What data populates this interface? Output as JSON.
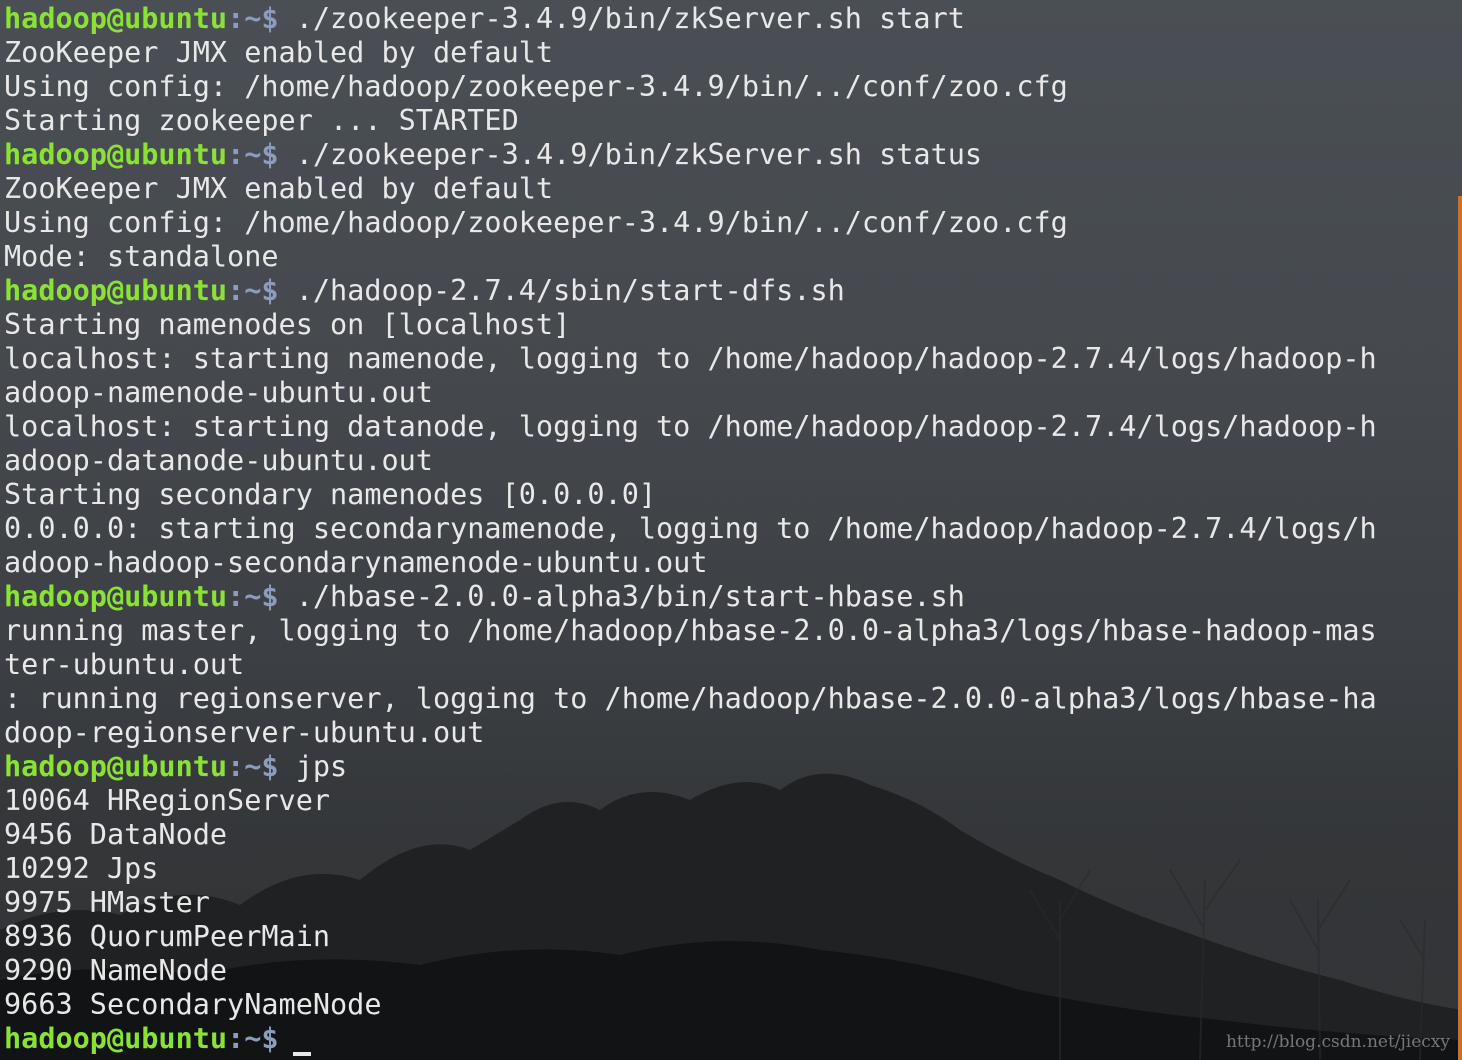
{
  "terminal": {
    "prompt": {
      "user_host": "hadoop@ubuntu",
      "sep": ":",
      "path": "~$"
    },
    "lines": [
      {
        "type": "cmd",
        "text": " ./zookeeper-3.4.9/bin/zkServer.sh start"
      },
      {
        "type": "out",
        "text": "ZooKeeper JMX enabled by default"
      },
      {
        "type": "out",
        "text": "Using config: /home/hadoop/zookeeper-3.4.9/bin/../conf/zoo.cfg"
      },
      {
        "type": "out",
        "text": "Starting zookeeper ... STARTED"
      },
      {
        "type": "cmd",
        "text": " ./zookeeper-3.4.9/bin/zkServer.sh status"
      },
      {
        "type": "out",
        "text": "ZooKeeper JMX enabled by default"
      },
      {
        "type": "out",
        "text": "Using config: /home/hadoop/zookeeper-3.4.9/bin/../conf/zoo.cfg"
      },
      {
        "type": "out",
        "text": "Mode: standalone"
      },
      {
        "type": "cmd",
        "text": " ./hadoop-2.7.4/sbin/start-dfs.sh"
      },
      {
        "type": "out",
        "text": "Starting namenodes on [localhost]"
      },
      {
        "type": "out",
        "text": "localhost: starting namenode, logging to /home/hadoop/hadoop-2.7.4/logs/hadoop-h"
      },
      {
        "type": "out",
        "text": "adoop-namenode-ubuntu.out"
      },
      {
        "type": "out",
        "text": "localhost: starting datanode, logging to /home/hadoop/hadoop-2.7.4/logs/hadoop-h"
      },
      {
        "type": "out",
        "text": "adoop-datanode-ubuntu.out"
      },
      {
        "type": "out",
        "text": "Starting secondary namenodes [0.0.0.0]"
      },
      {
        "type": "out",
        "text": "0.0.0.0: starting secondarynamenode, logging to /home/hadoop/hadoop-2.7.4/logs/h"
      },
      {
        "type": "out",
        "text": "adoop-hadoop-secondarynamenode-ubuntu.out"
      },
      {
        "type": "cmd",
        "text": " ./hbase-2.0.0-alpha3/bin/start-hbase.sh"
      },
      {
        "type": "out",
        "text": "running master, logging to /home/hadoop/hbase-2.0.0-alpha3/logs/hbase-hadoop-mas"
      },
      {
        "type": "out",
        "text": "ter-ubuntu.out"
      },
      {
        "type": "out",
        "text": ": running regionserver, logging to /home/hadoop/hbase-2.0.0-alpha3/logs/hbase-ha"
      },
      {
        "type": "out",
        "text": "doop-regionserver-ubuntu.out"
      },
      {
        "type": "cmd",
        "text": " jps"
      },
      {
        "type": "out",
        "text": "10064 HRegionServer"
      },
      {
        "type": "out",
        "text": "9456 DataNode"
      },
      {
        "type": "out",
        "text": "10292 Jps"
      },
      {
        "type": "out",
        "text": "9975 HMaster"
      },
      {
        "type": "out",
        "text": "8936 QuorumPeerMain"
      },
      {
        "type": "out",
        "text": "9290 NameNode"
      },
      {
        "type": "out",
        "text": "9663 SecondaryNameNode"
      },
      {
        "type": "cmd_cursor",
        "text": ""
      }
    ]
  },
  "watermark": "http://blog.csdn.net/jiecxy",
  "colors": {
    "prompt_user": "#8ae234",
    "prompt_path": "#8c9cbf",
    "output_text": "#e8e8e8",
    "scrollbar": "#c9712b"
  }
}
